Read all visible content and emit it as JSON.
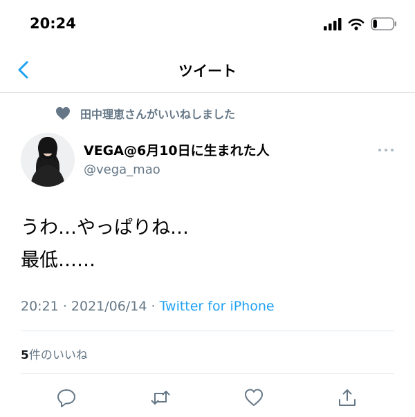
{
  "status_bar": {
    "time": "20:24",
    "battery_level": 0.2
  },
  "nav": {
    "title": "ツイート"
  },
  "tweet": {
    "liked_by": "田中理恵さんがいいねしました",
    "author": {
      "display_name": "VEGA@6月10日に生まれた人",
      "handle": "@vega_mao"
    },
    "text_lines": [
      "うわ…やっぱりね…",
      "最低……"
    ],
    "time": "20:21",
    "separator": "·",
    "date": "2021/06/14",
    "source": "Twitter for iPhone",
    "likes_count": "5",
    "likes_label": "件のいいね"
  },
  "colors": {
    "accent": "#1da1f2",
    "secondary_text": "#657786",
    "divider": "#e1e8ed"
  }
}
